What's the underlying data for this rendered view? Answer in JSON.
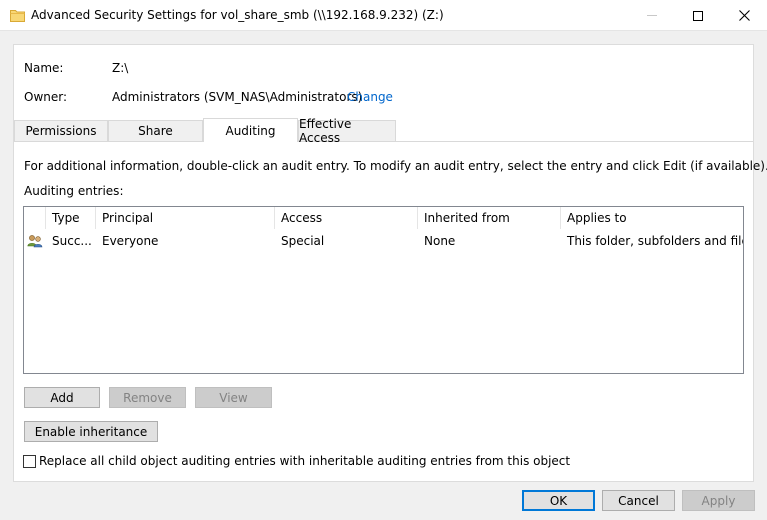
{
  "window": {
    "title": "Advanced Security Settings for vol_share_smb (\\\\192.168.9.232) (Z:)",
    "icon": "folder-icon"
  },
  "info": {
    "name_label": "Name:",
    "name_value": "Z:\\",
    "owner_label": "Owner:",
    "owner_value": "Administrators (SVM_NAS\\Administrators)",
    "change_link": "Change"
  },
  "tabs": [
    {
      "label": "Permissions",
      "active": false
    },
    {
      "label": "Share",
      "active": false
    },
    {
      "label": "Auditing",
      "active": true
    },
    {
      "label": "Effective Access",
      "active": false
    }
  ],
  "auditing": {
    "instructions": "For additional information, double-click an audit entry. To modify an audit entry, select the entry and click Edit (if available).",
    "entries_label": "Auditing entries:",
    "columns": [
      "Type",
      "Principal",
      "Access",
      "Inherited from",
      "Applies to"
    ],
    "rows": [
      {
        "icon": "users-icon",
        "type": "Succ...",
        "principal": "Everyone",
        "access": "Special",
        "inherited_from": "None",
        "applies_to": "This folder, subfolders and files"
      }
    ],
    "add_label": "Add",
    "remove_label": "Remove",
    "view_label": "View",
    "enable_inheritance_label": "Enable inheritance",
    "replace_checkbox_label": "Replace all child object auditing entries with inheritable auditing entries from this object",
    "replace_checked": false
  },
  "footer": {
    "ok_label": "OK",
    "cancel_label": "Cancel",
    "apply_label": "Apply"
  },
  "colors": {
    "accent": "#0078d7",
    "link": "#0066cc",
    "disabled_text": "#838383"
  }
}
